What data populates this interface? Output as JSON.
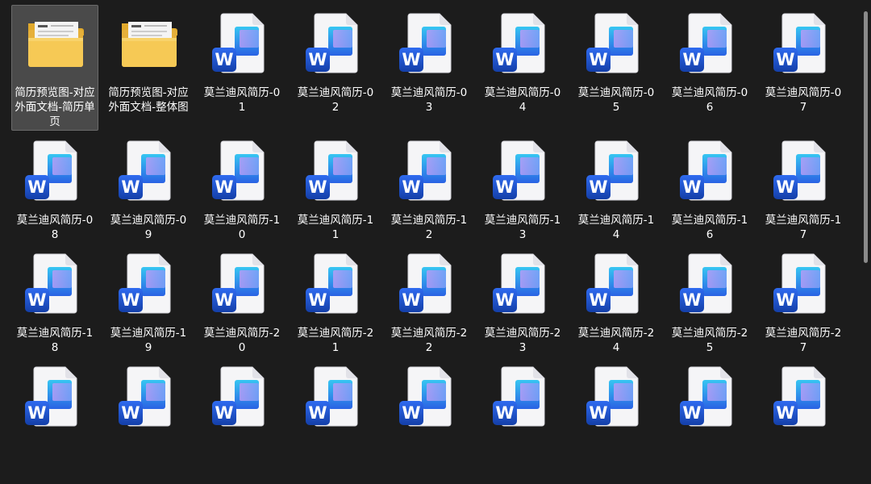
{
  "items": [
    {
      "kind": "folder",
      "label": "简历预览图-对应外面文档-简历单页",
      "selected": true
    },
    {
      "kind": "folder",
      "label": "简历预览图-对应外面文档-整体图"
    },
    {
      "kind": "doc",
      "label": "莫兰迪风简历-01"
    },
    {
      "kind": "doc",
      "label": "莫兰迪风简历-02"
    },
    {
      "kind": "doc",
      "label": "莫兰迪风简历-03"
    },
    {
      "kind": "doc",
      "label": "莫兰迪风简历-04"
    },
    {
      "kind": "doc",
      "label": "莫兰迪风简历-05"
    },
    {
      "kind": "doc",
      "label": "莫兰迪风简历-06"
    },
    {
      "kind": "doc",
      "label": "莫兰迪风简历-07"
    },
    {
      "kind": "doc",
      "label": "莫兰迪风简历-08"
    },
    {
      "kind": "doc",
      "label": "莫兰迪风简历-09"
    },
    {
      "kind": "doc",
      "label": "莫兰迪风简历-10"
    },
    {
      "kind": "doc",
      "label": "莫兰迪风简历-11"
    },
    {
      "kind": "doc",
      "label": "莫兰迪风简历-12"
    },
    {
      "kind": "doc",
      "label": "莫兰迪风简历-13"
    },
    {
      "kind": "doc",
      "label": "莫兰迪风简历-14"
    },
    {
      "kind": "doc",
      "label": "莫兰迪风简历-16"
    },
    {
      "kind": "doc",
      "label": "莫兰迪风简历-17"
    },
    {
      "kind": "doc",
      "label": "莫兰迪风简历-18"
    },
    {
      "kind": "doc",
      "label": "莫兰迪风简历-19"
    },
    {
      "kind": "doc",
      "label": "莫兰迪风简历-20"
    },
    {
      "kind": "doc",
      "label": "莫兰迪风简历-21"
    },
    {
      "kind": "doc",
      "label": "莫兰迪风简历-22"
    },
    {
      "kind": "doc",
      "label": "莫兰迪风简历-23"
    },
    {
      "kind": "doc",
      "label": "莫兰迪风简历-24"
    },
    {
      "kind": "doc",
      "label": "莫兰迪风简历-25"
    },
    {
      "kind": "doc",
      "label": "莫兰迪风简历-27"
    },
    {
      "kind": "doc",
      "label": ""
    },
    {
      "kind": "doc",
      "label": ""
    },
    {
      "kind": "doc",
      "label": ""
    },
    {
      "kind": "doc",
      "label": ""
    },
    {
      "kind": "doc",
      "label": ""
    },
    {
      "kind": "doc",
      "label": ""
    },
    {
      "kind": "doc",
      "label": ""
    },
    {
      "kind": "doc",
      "label": ""
    },
    {
      "kind": "doc",
      "label": ""
    }
  ],
  "word_badge_letter": "W",
  "colors": {
    "background": "#1c1c1c",
    "selected": "#4a4a4a",
    "word_blue": "#1f4fc4",
    "folder": "#f3c14b"
  }
}
